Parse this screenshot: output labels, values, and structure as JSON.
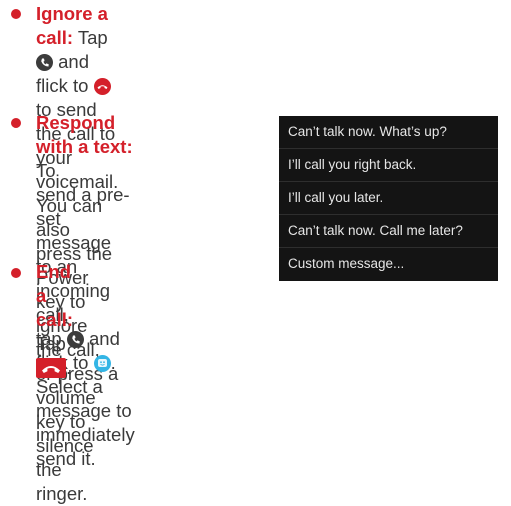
{
  "bullets": [
    {
      "label": "Ignore a call:",
      "lines": [
        [
          "Tap",
          "and flick to",
          "to send the call to"
        ],
        "your voicemail. You can also press the Power key to",
        "ignore the call, or press a volume key to silence the",
        "ringer."
      ]
    },
    {
      "label": "Respond with a text:",
      "lines": [
        "To",
        "send a pre-set message",
        "to an incoming call,",
        [
          "tap",
          "and flick to",
          "."
        ],
        "Select a message to",
        "immediately send it."
      ]
    },
    {
      "label": "End a call:",
      "lines": [
        [
          "Tap",
          "."
        ]
      ]
    }
  ],
  "message_menu": {
    "items": [
      "Can’t talk now. What’s up?",
      "I’ll call you right back.",
      "I’ll call you later.",
      "Can’t talk now. Call me later?",
      "Custom message..."
    ]
  },
  "icons": {
    "call_icon": "phone-circle-icon",
    "decline_icon": "decline-circle-icon",
    "text_icon": "message-smiley-icon",
    "end_call_icon": "end-call-icon"
  },
  "colors": {
    "accent": "#d4202a",
    "text": "#3a3a3a",
    "menu_bg": "#141414",
    "menu_text": "#e6e6e6",
    "text_icon": "#33b5e5"
  }
}
